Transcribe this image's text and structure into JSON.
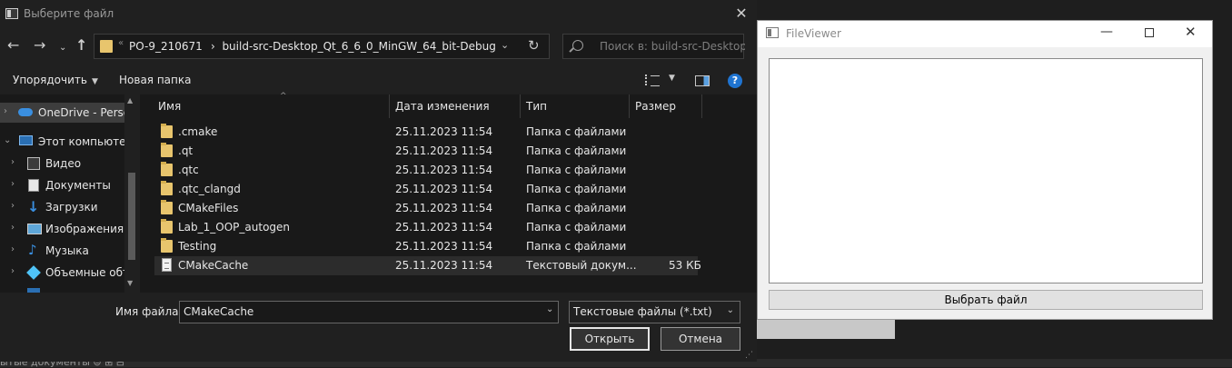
{
  "dialog": {
    "title": "Выберите файл",
    "address": {
      "crumbs": [
        "PO-9_210671",
        "build-src-Desktop_Qt_6_6_0_MinGW_64_bit-Debug"
      ],
      "overflow_glyph": "«"
    },
    "search_placeholder": "Поиск в: build-src-Desktop_...",
    "toolbar": {
      "organize_label": "Упорядочить",
      "new_folder_label": "Новая папка",
      "help_label": "?"
    },
    "tree": [
      {
        "label": "OneDrive - Person",
        "icon": "cloud-icon",
        "selected": true
      },
      {
        "label": "Этот компьютер",
        "icon": "computer-icon"
      },
      {
        "label": "Видео",
        "icon": "video-icon"
      },
      {
        "label": "Документы",
        "icon": "documents-icon"
      },
      {
        "label": "Загрузки",
        "icon": "downloads-icon"
      },
      {
        "label": "Изображения",
        "icon": "pictures-icon"
      },
      {
        "label": "Музыка",
        "icon": "music-icon"
      },
      {
        "label": "Объемные объ",
        "icon": "3d-objects-icon"
      }
    ],
    "columns": [
      "Имя",
      "Дата изменения",
      "Тип",
      "Размер"
    ],
    "files": [
      {
        "name": ".cmake",
        "date": "25.11.2023 11:54",
        "type": "Папка с файлами",
        "size": "",
        "kind": "folder"
      },
      {
        "name": ".qt",
        "date": "25.11.2023 11:54",
        "type": "Папка с файлами",
        "size": "",
        "kind": "folder"
      },
      {
        "name": ".qtc",
        "date": "25.11.2023 11:54",
        "type": "Папка с файлами",
        "size": "",
        "kind": "folder"
      },
      {
        "name": ".qtc_clangd",
        "date": "25.11.2023 11:54",
        "type": "Папка с файлами",
        "size": "",
        "kind": "folder"
      },
      {
        "name": "CMakeFiles",
        "date": "25.11.2023 11:54",
        "type": "Папка с файлами",
        "size": "",
        "kind": "folder"
      },
      {
        "name": "Lab_1_OOP_autogen",
        "date": "25.11.2023 11:54",
        "type": "Папка с файлами",
        "size": "",
        "kind": "folder"
      },
      {
        "name": "Testing",
        "date": "25.11.2023 11:54",
        "type": "Папка с файлами",
        "size": "",
        "kind": "folder"
      },
      {
        "name": "CMakeCache",
        "date": "25.11.2023 11:54",
        "type": "Текстовый докум...",
        "size": "53 КБ",
        "kind": "text",
        "selected": true
      }
    ],
    "filename_label": "Имя файла:",
    "filename_value": "CMakeCache",
    "filetype_value": "Текстовые файлы (*.txt)",
    "open_label": "Открыть",
    "cancel_label": "Отмена"
  },
  "fileviewer": {
    "title": "FileViewer",
    "select_button": "Выбрать файл"
  },
  "background": {
    "statusbar_text": "ытые документы  ⊜  ⊞  ⊟"
  },
  "colors": {
    "dialog_bg": "#202020",
    "folder": "#e8c56d",
    "accent": "#1f74d1"
  }
}
